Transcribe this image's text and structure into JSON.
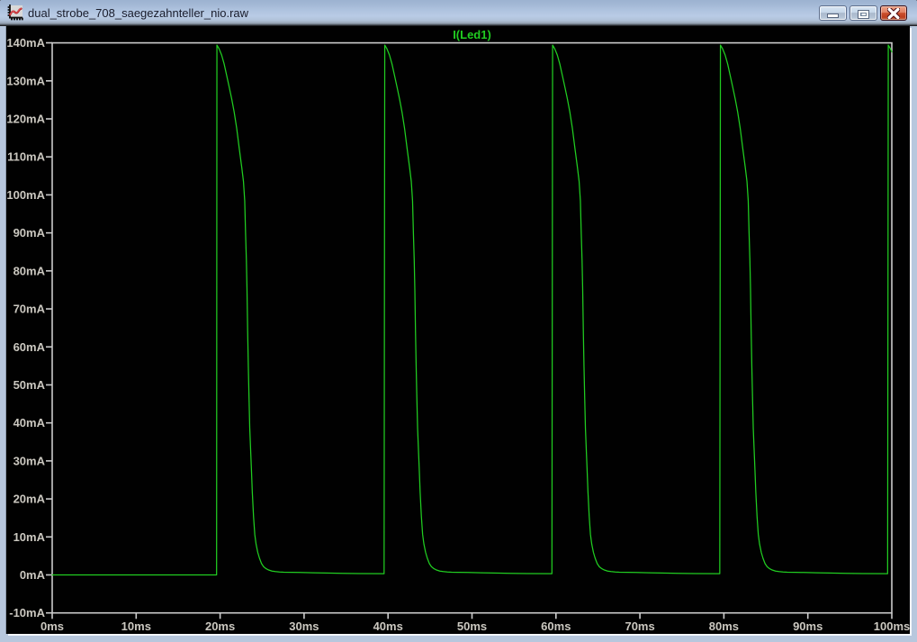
{
  "window": {
    "title": "dual_strobe_708_saegezahnteller_nio.raw",
    "app_icon": "waveform-chart-icon",
    "controls": [
      {
        "name": "minimize",
        "icon": "minimize-icon"
      },
      {
        "name": "maximize",
        "icon": "maximize-icon"
      },
      {
        "name": "close",
        "icon": "close-icon"
      }
    ]
  },
  "colors": {
    "plot_background": "#010101",
    "plot_border": "#cbcbcb",
    "tick_label": "#cbc8c0",
    "trace_green": "#21cd21",
    "titlebar_text": "#191c2b",
    "frame_blue": "#b6c6dc"
  },
  "chart_data": {
    "type": "line",
    "title": "I(Led1)",
    "legend_position": "top-center",
    "grid": false,
    "background": "#010101",
    "x_axis": {
      "unit": "ms",
      "min": 0,
      "max": 100,
      "tick_step": 10,
      "tick_values": [
        0,
        10,
        20,
        30,
        40,
        50,
        60,
        70,
        80,
        90,
        100
      ],
      "tick_labels": [
        "0ms",
        "10ms",
        "20ms",
        "30ms",
        "40ms",
        "50ms",
        "60ms",
        "70ms",
        "80ms",
        "90ms",
        "100ms"
      ]
    },
    "y_axis": {
      "unit": "mA",
      "min": -10,
      "max": 140,
      "tick_step": 10,
      "tick_values": [
        -10,
        0,
        10,
        20,
        30,
        40,
        50,
        60,
        70,
        80,
        90,
        100,
        110,
        120,
        130,
        140
      ],
      "tick_labels": [
        "-10mA",
        "0mA",
        "10mA",
        "20mA",
        "30mA",
        "40mA",
        "50mA",
        "60mA",
        "70mA",
        "80mA",
        "90mA",
        "100mA",
        "110mA",
        "120mA",
        "130mA",
        "140mA"
      ]
    },
    "series": [
      {
        "name": "I(Led1)",
        "color": "#21cd21",
        "description": "LED strobe current: 20ms period spikes rising to ~139mA then decaying to ~0mA",
        "points": [
          [
            0.0,
            0.0
          ],
          [
            10.0,
            0.0
          ],
          [
            19.58,
            0.0
          ],
          [
            19.62,
            139.4
          ],
          [
            19.88,
            138.43
          ],
          [
            20.18,
            136.8
          ],
          [
            20.48,
            134.44
          ],
          [
            20.78,
            131.44
          ],
          [
            21.08,
            128.38
          ],
          [
            21.38,
            125.24
          ],
          [
            21.68,
            121.71
          ],
          [
            21.98,
            117.45
          ],
          [
            22.28,
            112.21
          ],
          [
            22.58,
            107.18
          ],
          [
            22.78,
            103.54
          ],
          [
            22.93,
            98.42
          ],
          [
            23.03,
            90.0
          ],
          [
            23.13,
            82.67
          ],
          [
            23.2,
            75.36
          ],
          [
            23.28,
            64.12
          ],
          [
            23.36,
            54.76
          ],
          [
            23.44,
            46.83
          ],
          [
            23.53,
            38.61
          ],
          [
            23.63,
            33.1
          ],
          [
            23.73,
            27.69
          ],
          [
            23.83,
            21.93
          ],
          [
            23.98,
            15.4
          ],
          [
            24.13,
            10.61
          ],
          [
            24.28,
            8.13
          ],
          [
            24.48,
            5.95
          ],
          [
            24.68,
            4.44
          ],
          [
            24.93,
            2.99
          ],
          [
            25.18,
            2.16
          ],
          [
            25.48,
            1.63
          ],
          [
            25.78,
            1.3
          ],
          [
            26.18,
            1.01
          ],
          [
            26.58,
            0.88
          ],
          [
            27.08,
            0.78
          ],
          [
            27.58,
            0.72
          ],
          [
            28.58,
            0.67
          ],
          [
            29.58,
            0.64
          ],
          [
            31.08,
            0.57
          ],
          [
            32.58,
            0.49
          ],
          [
            34.58,
            0.42
          ],
          [
            36.58,
            0.36
          ],
          [
            39.53,
            0.31
          ],
          [
            39.61,
            139.4
          ],
          [
            39.87,
            138.43
          ],
          [
            40.17,
            136.8
          ],
          [
            40.47,
            134.44
          ],
          [
            40.77,
            131.44
          ],
          [
            41.07,
            128.38
          ],
          [
            41.37,
            125.24
          ],
          [
            41.67,
            121.71
          ],
          [
            41.97,
            117.45
          ],
          [
            42.27,
            112.21
          ],
          [
            42.57,
            107.18
          ],
          [
            42.77,
            103.54
          ],
          [
            42.92,
            98.42
          ],
          [
            43.02,
            90.0
          ],
          [
            43.12,
            82.67
          ],
          [
            43.19,
            75.36
          ],
          [
            43.27,
            64.12
          ],
          [
            43.35,
            54.76
          ],
          [
            43.43,
            46.83
          ],
          [
            43.52,
            38.61
          ],
          [
            43.62,
            33.1
          ],
          [
            43.72,
            27.69
          ],
          [
            43.82,
            21.93
          ],
          [
            43.97,
            15.4
          ],
          [
            44.12,
            10.61
          ],
          [
            44.27,
            8.13
          ],
          [
            44.47,
            5.95
          ],
          [
            44.67,
            4.44
          ],
          [
            44.92,
            2.99
          ],
          [
            45.17,
            2.16
          ],
          [
            45.47,
            1.63
          ],
          [
            45.77,
            1.3
          ],
          [
            46.17,
            1.01
          ],
          [
            46.57,
            0.88
          ],
          [
            47.07,
            0.78
          ],
          [
            47.57,
            0.72
          ],
          [
            48.57,
            0.67
          ],
          [
            49.57,
            0.64
          ],
          [
            51.07,
            0.57
          ],
          [
            52.57,
            0.49
          ],
          [
            54.57,
            0.42
          ],
          [
            56.57,
            0.36
          ],
          [
            59.52,
            0.31
          ],
          [
            59.6,
            139.4
          ],
          [
            59.86,
            138.43
          ],
          [
            60.16,
            136.8
          ],
          [
            60.46,
            134.44
          ],
          [
            60.76,
            131.44
          ],
          [
            61.06,
            128.38
          ],
          [
            61.36,
            125.24
          ],
          [
            61.66,
            121.71
          ],
          [
            61.96,
            117.45
          ],
          [
            62.26,
            112.21
          ],
          [
            62.56,
            107.18
          ],
          [
            62.76,
            103.54
          ],
          [
            62.91,
            98.42
          ],
          [
            63.01,
            90.0
          ],
          [
            63.11,
            82.67
          ],
          [
            63.18,
            75.36
          ],
          [
            63.26,
            64.12
          ],
          [
            63.34,
            54.76
          ],
          [
            63.42,
            46.83
          ],
          [
            63.51,
            38.61
          ],
          [
            63.61,
            33.1
          ],
          [
            63.71,
            27.69
          ],
          [
            63.81,
            21.93
          ],
          [
            63.96,
            15.4
          ],
          [
            64.11,
            10.61
          ],
          [
            64.26,
            8.13
          ],
          [
            64.46,
            5.95
          ],
          [
            64.66,
            4.44
          ],
          [
            64.91,
            2.99
          ],
          [
            65.16,
            2.16
          ],
          [
            65.46,
            1.63
          ],
          [
            65.76,
            1.3
          ],
          [
            66.16,
            1.01
          ],
          [
            66.56,
            0.88
          ],
          [
            67.06,
            0.78
          ],
          [
            67.56,
            0.72
          ],
          [
            68.56,
            0.67
          ],
          [
            69.56,
            0.64
          ],
          [
            71.06,
            0.57
          ],
          [
            72.56,
            0.49
          ],
          [
            74.56,
            0.42
          ],
          [
            76.56,
            0.36
          ],
          [
            79.51,
            0.31
          ],
          [
            79.59,
            139.4
          ],
          [
            79.85,
            138.43
          ],
          [
            80.15,
            136.8
          ],
          [
            80.45,
            134.44
          ],
          [
            80.75,
            131.44
          ],
          [
            81.05,
            128.38
          ],
          [
            81.35,
            125.24
          ],
          [
            81.65,
            121.71
          ],
          [
            81.95,
            117.45
          ],
          [
            82.25,
            112.21
          ],
          [
            82.55,
            107.18
          ],
          [
            82.75,
            103.54
          ],
          [
            82.9,
            98.42
          ],
          [
            83.0,
            90.0
          ],
          [
            83.1,
            82.67
          ],
          [
            83.17,
            75.36
          ],
          [
            83.25,
            64.12
          ],
          [
            83.33,
            54.76
          ],
          [
            83.41,
            46.83
          ],
          [
            83.5,
            38.61
          ],
          [
            83.6,
            33.1
          ],
          [
            83.7,
            27.69
          ],
          [
            83.8,
            21.93
          ],
          [
            83.95,
            15.4
          ],
          [
            84.1,
            10.61
          ],
          [
            84.25,
            8.13
          ],
          [
            84.45,
            5.95
          ],
          [
            84.65,
            4.44
          ],
          [
            84.9,
            2.99
          ],
          [
            85.15,
            2.16
          ],
          [
            85.45,
            1.63
          ],
          [
            85.75,
            1.3
          ],
          [
            86.15,
            1.01
          ],
          [
            86.55,
            0.88
          ],
          [
            87.05,
            0.78
          ],
          [
            87.55,
            0.72
          ],
          [
            88.55,
            0.67
          ],
          [
            89.55,
            0.64
          ],
          [
            91.05,
            0.57
          ],
          [
            92.55,
            0.49
          ],
          [
            94.55,
            0.42
          ],
          [
            96.55,
            0.36
          ],
          [
            99.5,
            0.31
          ],
          [
            99.58,
            139.4
          ],
          [
            99.84,
            138.43
          ],
          [
            100.0,
            137.61
          ]
        ]
      }
    ]
  }
}
